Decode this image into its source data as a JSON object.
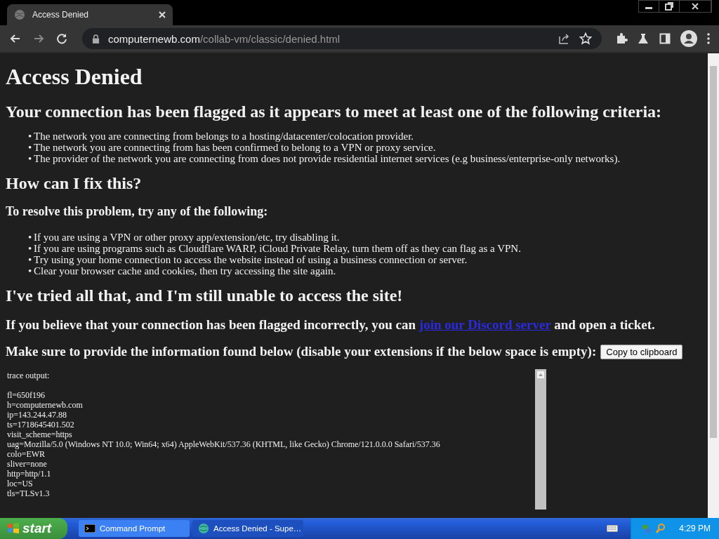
{
  "tab": {
    "title": "Access Denied",
    "selected": true
  },
  "address": {
    "domain": "computernewb.com",
    "path": "/collab-vm/classic/denied.html"
  },
  "page": {
    "title": "Access Denied",
    "heading": "Your connection has been flagged as it appears to meet at least one of the following criteria:",
    "criteria": [
      {
        "marker": "•",
        "text": "The network you are connecting from belongs to a hosting/datacenter/colocation provider."
      },
      {
        "marker": "•",
        "text": "The network you are connecting from has been confirmed to belong to a VPN or proxy service."
      },
      {
        "marker": "•",
        "text": "The provider of the network you are connecting from does not provide residential internet services (e.g business/enterprise-only networks)."
      }
    ],
    "fix_heading": "How can I fix this?",
    "resolve_heading": "To resolve this problem, try any of the following:",
    "steps": [
      {
        "marker": "•",
        "text": "If you are using a VPN or other proxy app/extension/etc, try disabling it."
      },
      {
        "marker": "•",
        "text": "If you are using programs such as Cloudflare WARP, iCloud Private Relay, turn them off as they can flag as a VPN."
      },
      {
        "marker": "•",
        "text": "Try using your home connection to access the website instead of using a business connection or server."
      },
      {
        "marker": "•",
        "text": "Clear your browser cache and cookies, then try accessing the site again."
      }
    ],
    "tried_heading": "I've tried all that, and I'm still unable to access the site!",
    "contact": {
      "before": "If you believe that your connection has been flagged incorrectly, you can",
      "link": "join our Discord server",
      "after": "and open a ticket."
    },
    "provide": "Make sure to provide the information found below (disable your extensions if the below space is empty):",
    "copy_button": "Copy to clipboard",
    "trace_label": "trace output:",
    "trace": [
      "fl=650f196",
      "h=computernewb.com",
      "ip=143.244.47.88",
      "ts=1718645401.502",
      "visit_scheme=https",
      "uag=Mozilla/5.0 (Windows NT 10.0; Win64; x64) AppleWebKit/537.36 (KHTML, like Gecko) Chrome/121.0.0.0 Safari/537.36",
      "colo=EWR",
      "sliver=none",
      "http=http/1.1",
      "loc=US",
      "tls=TLSv1.3"
    ]
  },
  "taskbar": {
    "start": "start",
    "tasks": [
      {
        "label": "Command Prompt",
        "selected": false,
        "kind": "console"
      },
      {
        "label": "Access Denied - Supe…",
        "selected": true,
        "kind": "browser"
      }
    ],
    "clock": "4:29 PM"
  }
}
